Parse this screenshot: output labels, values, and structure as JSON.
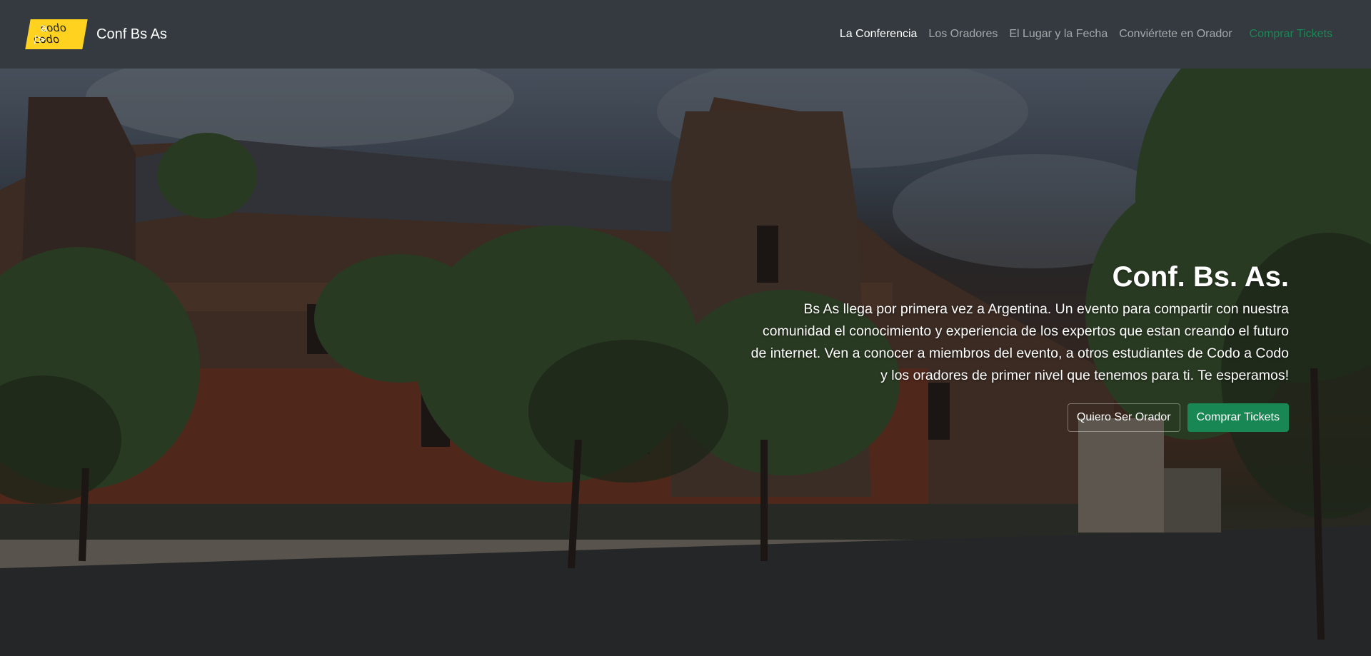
{
  "brand": {
    "logo_line1": "codo",
    "logo_line1_accent": "a",
    "logo_line2": "codo",
    "logo_line2_accent": "/>",
    "name": "Conf Bs As"
  },
  "nav": {
    "items": [
      {
        "label": "La Conferencia",
        "active": true
      },
      {
        "label": "Los Oradores"
      },
      {
        "label": "El Lugar y la Fecha"
      },
      {
        "label": "Conviértete en Orador"
      }
    ],
    "tickets_label": "Comprar Tickets"
  },
  "hero": {
    "title": "Conf. Bs. As.",
    "text": "Bs As llega por primera vez a Argentina. Un evento para compartir con nuestra comunidad el conocimiento y experiencia de los expertos que estan creando el futuro de internet. Ven a conocer a miembros del evento, a otros estudiantes de Codo a Codo y los oradores de primer nivel que tenemos para ti. Te esperamos!",
    "orador_button": "Quiero Ser Orador",
    "tickets_button": "Comprar Tickets"
  },
  "colors": {
    "navbar": "#343a40",
    "logo": "#ffd21f",
    "success": "#198754"
  }
}
